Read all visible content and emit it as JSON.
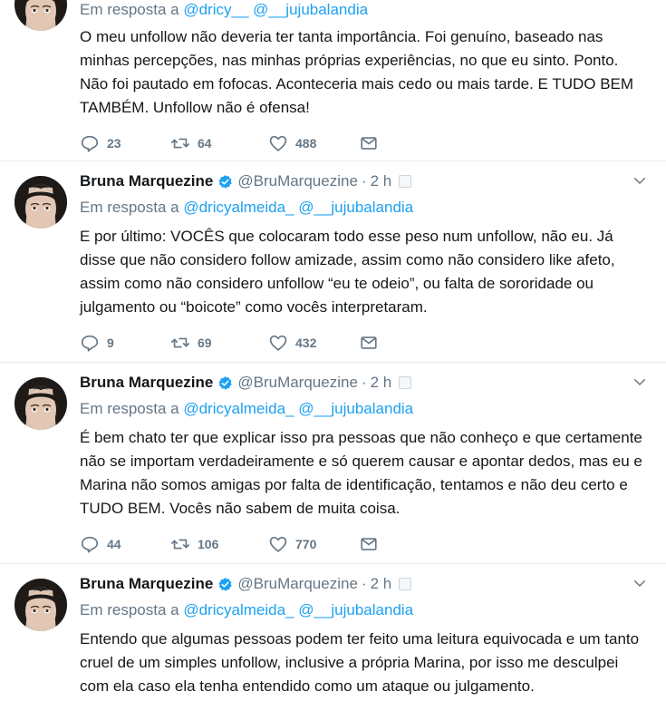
{
  "tweets": [
    {
      "name": "",
      "handle": "",
      "time": "",
      "reply_prefix": "Em resposta a",
      "reply_to": [
        "@dricy__",
        "@__jujubalandia"
      ],
      "text": "O meu unfollow não deveria ter tanta importância. Foi genuíno, baseado nas minhas percepções, nas minhas próprias experiências, no que eu sinto. Ponto. Não foi pautado em fofocas. Aconteceria mais cedo ou mais tarde. E TUDO BEM TAMBÉM. Unfollow não é ofensa!",
      "replies": "23",
      "retweets": "64",
      "likes": "488"
    },
    {
      "name": "Bruna Marquezine",
      "handle": "@BruMarquezine",
      "time": "2 h",
      "reply_prefix": "Em resposta a",
      "reply_to": [
        "@dricyalmeida_",
        "@__jujubalandia"
      ],
      "text": "E por último: VOCÊS que colocaram todo esse peso num unfollow, não eu. Já disse que não considero follow amizade, assim como não considero like afeto, assim como não considero unfollow “eu te odeio”, ou falta de sororidade ou julgamento ou “boicote” como vocês interpretaram.",
      "replies": "9",
      "retweets": "69",
      "likes": "432"
    },
    {
      "name": "Bruna Marquezine",
      "handle": "@BruMarquezine",
      "time": "2 h",
      "reply_prefix": "Em resposta a",
      "reply_to": [
        "@dricyalmeida_",
        "@__jujubalandia"
      ],
      "text": "É bem chato ter que explicar isso pra pessoas que não conheço e que certamente não se importam verdadeiramente e só querem causar e apontar dedos, mas eu e Marina não somos amigas por falta de identificação, tentamos e não deu certo e TUDO BEM. Vocês não sabem de muita coisa.",
      "replies": "44",
      "retweets": "106",
      "likes": "770"
    },
    {
      "name": "Bruna Marquezine",
      "handle": "@BruMarquezine",
      "time": "2 h",
      "reply_prefix": "Em resposta a",
      "reply_to": [
        "@dricyalmeida_",
        "@__jujubalandia"
      ],
      "text": "Entendo que algumas pessoas podem ter feito uma leitura equivocada e um tanto cruel de um simples unfollow, inclusive a própria Marina, por isso me desculpei com ela caso ela tenha entendido como um ataque ou julgamento.",
      "replies": "",
      "retweets": "",
      "likes": ""
    }
  ],
  "colors": {
    "link": "#1da1f2",
    "secondary": "#657786",
    "border": "#e6ecf0",
    "verified": "#1da1f2"
  },
  "icons": [
    "reply-icon",
    "retweet-icon",
    "like-icon",
    "dm-icon",
    "verified-icon",
    "chevron-down-icon",
    "translate-icon"
  ]
}
